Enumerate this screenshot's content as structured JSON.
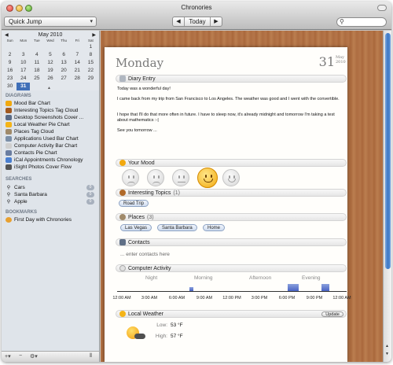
{
  "window": {
    "title": "Chronories"
  },
  "toolbar": {
    "quick_jump": "Quick Jump",
    "nav_prev": "◀",
    "today": "Today",
    "nav_next": "▶",
    "search_placeholder": ""
  },
  "calendar": {
    "month_title": "May 2010",
    "day_names": [
      "Sun",
      "Mon",
      "Tue",
      "Wed",
      "Thu",
      "Fri",
      "Sat"
    ],
    "days": [
      "",
      "",
      "",
      "",
      "",
      "",
      "1",
      "2",
      "3",
      "4",
      "5",
      "6",
      "7",
      "8",
      "9",
      "10",
      "11",
      "12",
      "13",
      "14",
      "15",
      "16",
      "17",
      "18",
      "19",
      "20",
      "21",
      "22",
      "23",
      "24",
      "25",
      "26",
      "27",
      "28",
      "29",
      "30",
      "31",
      "",
      "",
      "",
      "",
      ""
    ],
    "selected_day": "31"
  },
  "sidebar": {
    "diagrams_label": "DIAGRAMS",
    "diagrams": [
      {
        "label": "Mood Bar Chart",
        "icon": "smiley-icon"
      },
      {
        "label": "Interesting Topics Tag Cloud",
        "icon": "topics-icon"
      },
      {
        "label": "Desktop Screenshots Cover ...",
        "icon": "screenshot-icon"
      },
      {
        "label": "Local Weather Pie Chart",
        "icon": "sun-icon"
      },
      {
        "label": "Places Tag Cloud",
        "icon": "places-icon"
      },
      {
        "label": "Applications Used Bar Chart",
        "icon": "applications-icon"
      },
      {
        "label": "Computer Activity Bar Chart",
        "icon": "activity-icon"
      },
      {
        "label": "Contacts Pie Chart",
        "icon": "contacts-icon"
      },
      {
        "label": "iCal Appointments Chronology",
        "icon": "ical-icon"
      },
      {
        "label": "iSight Photos Cover Flow",
        "icon": "camera-icon"
      }
    ],
    "searches_label": "SEARCHES",
    "searches": [
      {
        "label": "Cars",
        "count": "0"
      },
      {
        "label": "Santa Barbara",
        "count": "0"
      },
      {
        "label": "Apple",
        "count": "0"
      }
    ],
    "bookmarks_label": "BOOKMARKS",
    "bookmarks": [
      {
        "label": "First Day with Chronories"
      }
    ],
    "footer": {
      "add": "+▾",
      "remove": "−",
      "action": "⚙▾",
      "resize": "⦀"
    }
  },
  "day": {
    "name": "Monday",
    "number": "31",
    "month": "May",
    "year": "2010"
  },
  "diary": {
    "title": "Diary Entry",
    "paragraphs": [
      "Today was a wonderful day!",
      "I came back from my trip from San Francisco to Los Angeles. The weather was good and I went with the convertible.",
      "I hope that I'll do that more often in future. I have to sleep now, it's already midnight and tomorrow I'm taking a test about mathematics :-|",
      "See you tomorrow ..."
    ]
  },
  "mood": {
    "title": "Your Mood",
    "selected_index": 3,
    "levels": [
      "very-sad",
      "sad",
      "neutral",
      "happy",
      "very-happy"
    ]
  },
  "topics": {
    "title": "Interesting Topics",
    "count": "(1)",
    "tags": [
      "Road Trip"
    ]
  },
  "places": {
    "title": "Places",
    "count": "(3)",
    "tags": [
      "Las Vegas",
      "Santa Barbara",
      "Home"
    ]
  },
  "contacts": {
    "title": "Contacts",
    "placeholder": "... enter contacts here"
  },
  "activity": {
    "title": "Computer Activity",
    "periods": [
      "Night",
      "Morning",
      "Afternoon",
      "Evening"
    ],
    "ticks": [
      "12:00 AM",
      "3:00 AM",
      "6:00 AM",
      "9:00 AM",
      "12:00 PM",
      "3:00 PM",
      "6:00 PM",
      "9:00 PM",
      "12:00 AM"
    ]
  },
  "weather": {
    "title": "Local Weather",
    "update": "Update",
    "low_label": "Low:",
    "low_value": "53 °F",
    "high_label": "High:",
    "high_value": "57 °F"
  },
  "colors": {
    "accent": "#3f6fb8",
    "mood_active": "#f2a90f",
    "activity_bar": "#5a72cc"
  }
}
